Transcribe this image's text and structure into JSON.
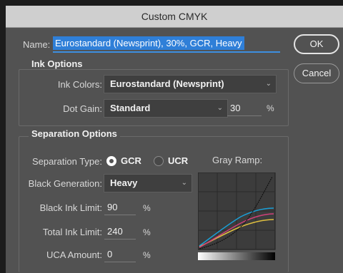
{
  "dialog": {
    "title": "Custom CMYK",
    "name_label": "Name:",
    "name_value": "Eurostandard (Newsprint), 30%, GCR, Heavy",
    "buttons": {
      "ok": "OK",
      "cancel": "Cancel"
    }
  },
  "ink_options": {
    "title": "Ink Options",
    "ink_colors_label": "Ink Colors:",
    "ink_colors_value": "Eurostandard (Newsprint)",
    "dot_gain_label": "Dot Gain:",
    "dot_gain_value": "Standard",
    "dot_gain_amount": "30",
    "percent": "%"
  },
  "separation_options": {
    "title": "Separation Options",
    "separation_type_label": "Separation Type:",
    "gcr_label": "GCR",
    "ucr_label": "UCR",
    "selected_type": "GCR",
    "black_generation_label": "Black Generation:",
    "black_generation_value": "Heavy",
    "black_ink_limit_label": "Black Ink Limit:",
    "black_ink_limit_value": "90",
    "total_ink_limit_label": "Total Ink Limit:",
    "total_ink_limit_value": "240",
    "uca_amount_label": "UCA Amount:",
    "uca_amount_value": "0",
    "percent": "%",
    "gray_ramp_label": "Gray Ramp:"
  },
  "icons": {
    "dropdown": "chevron-down-icon",
    "radio_selected": "radio-selected-icon",
    "radio_unselected": "radio-unselected-icon"
  },
  "colors": {
    "dialog_bg": "#525252",
    "titlebar_bg": "#cfcfcf",
    "selection_blue": "#2f7fd8",
    "curve_cyan": "#1aa0d8",
    "curve_magenta": "#d0407a",
    "curve_yellow": "#e0c040",
    "curve_black": "#111111"
  }
}
